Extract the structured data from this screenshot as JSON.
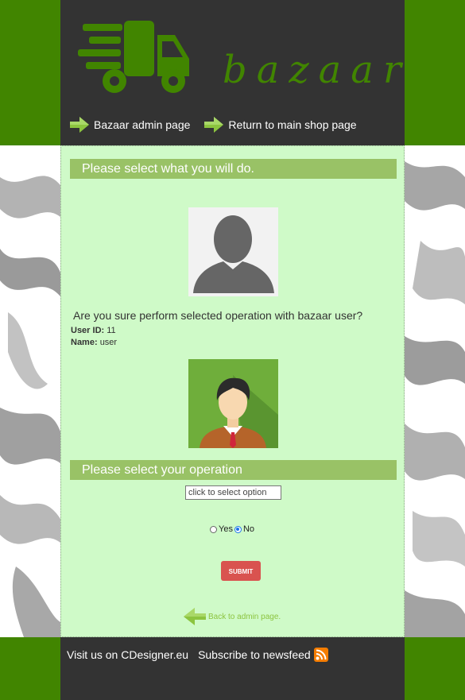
{
  "brand": {
    "logo_text": "bazaar",
    "accent": "#418500"
  },
  "nav": {
    "items": [
      {
        "label": "Bazaar admin page"
      },
      {
        "label": "Return to main shop page"
      }
    ]
  },
  "main": {
    "title": "Please select what you will do.",
    "confirm_text": "Are you sure perform selected operation with bazaar user?",
    "user_id_label": "User ID:",
    "user_id_value": "11",
    "name_label": "Name:",
    "name_value": "user",
    "operation_title": "Please select your operation",
    "select": {
      "placeholder": "click to select option"
    },
    "radio": {
      "yes_label": "Yes",
      "no_label": "No",
      "selected": "No"
    },
    "submit_label": "SUBMIT",
    "back_label": "Back to admin page."
  },
  "footer": {
    "visit_label": "Visit us on CDesigner.eu",
    "subscribe_label": "Subscribe to newsfeed"
  },
  "colors": {
    "header_bg": "#333333",
    "content_bg": "#cffac8",
    "section_bar": "#99c266",
    "submit_bg": "#d9534f",
    "rss": "#f57d00"
  }
}
